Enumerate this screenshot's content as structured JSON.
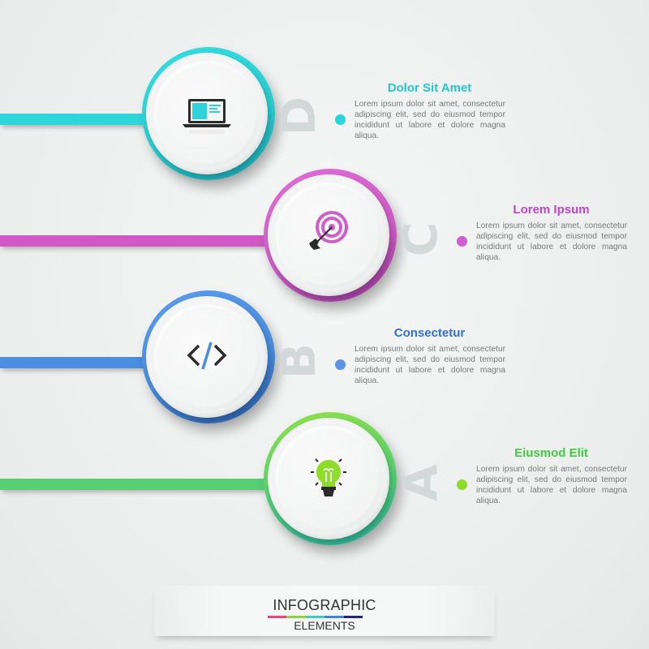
{
  "steps": [
    {
      "letter": "D",
      "title": "Dolor Sit Amet",
      "description": "Lorem ipsum dolor sit amet, consectetur adipiscing elit, sed do eiusmod tempor incididunt ut labore et dolore magna aliqua.",
      "icon": "laptop-icon",
      "color": "#2fd6d9",
      "color_dark": "#1aa8b0"
    },
    {
      "letter": "C",
      "title": "Lorem Ipsum",
      "description": "Lorem ipsum dolor sit amet, consectetur adipiscing elit, sed do eiusmod tempor incididunt ut labore et dolore magna aliqua.",
      "icon": "target-arrow-icon",
      "color": "#d65fcb",
      "color_dark": "#9b3a98"
    },
    {
      "letter": "B",
      "title": "Consectetur",
      "description": "Lorem ipsum dolor sit amet, consectetur adipiscing elit, sed do eiusmod tempor incididunt ut labore et dolore magna aliqua.",
      "icon": "code-icon",
      "color": "#4a90e2",
      "color_dark": "#2a62b0"
    },
    {
      "letter": "A",
      "title": "Eiusmod Elit",
      "description": "Lorem ipsum dolor sit amet, consectetur adipiscing elit, sed do eiusmod tempor incididunt ut labore et dolore magna aliqua.",
      "icon": "lightbulb-icon",
      "color": "#5fd56b",
      "color_dark": "#2bb3a0"
    }
  ],
  "title_colors": [
    "#26c7cc",
    "#c245c8",
    "#2f6fd6",
    "#3fcc3f"
  ],
  "dot_colors": [
    "#2ad6de",
    "#d35fd6",
    "#5a93e6",
    "#8edc2a"
  ],
  "banner": {
    "title": "INFOGRAPHIC",
    "subtitle": "ELEMENTS",
    "stripe_colors": [
      "#f0407f",
      "#8bd43a",
      "#35d3c6",
      "#3d86e0",
      "#22237a"
    ]
  }
}
